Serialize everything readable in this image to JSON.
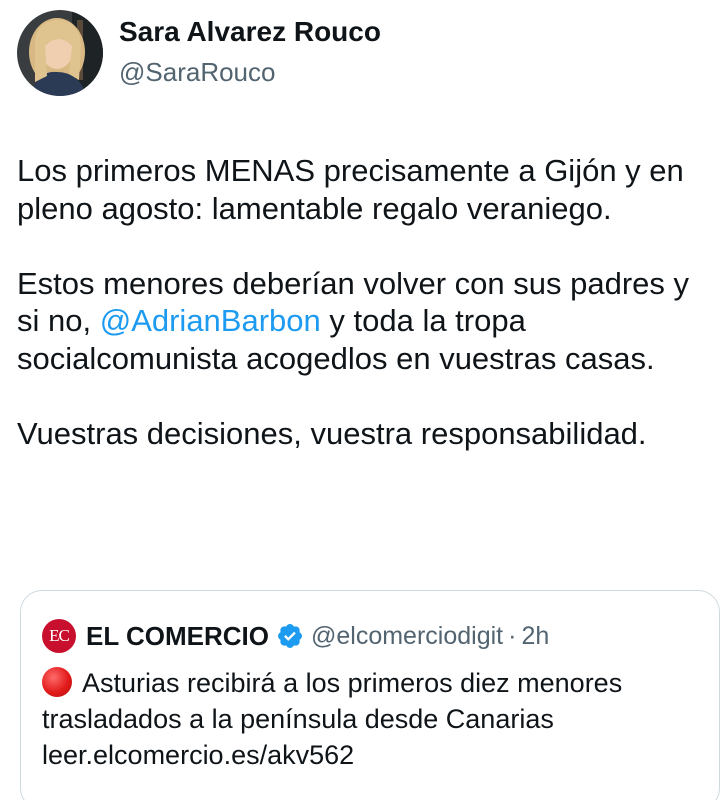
{
  "author": {
    "name": "Sara Alvarez Rouco",
    "handle": "@SaraRouco",
    "avatar_icon": "profile-photo"
  },
  "tweet": {
    "paragraph1": "Los primeros MENAS precisamente a Gijón y en pleno agosto: lamentable regalo veraniego.",
    "paragraph2_before": "Estos menores deberían volver con sus padres y si no, ",
    "paragraph2_mention": "@AdrianBarbon",
    "paragraph2_after": " y toda la tropa socialcomunista  acogedlos en vuestras casas.",
    "paragraph3": "Vuestras decisiones, vuestra responsabilidad."
  },
  "quoted": {
    "logo_text": "EC",
    "name": "EL COMERCIO",
    "handle": "@elcomerciodigit",
    "separator": "·",
    "time": "2h",
    "text_line1": "Asturias recibirá a los primeros diez menores",
    "text_line2": "trasladados a la península desde Canarias",
    "link": "leer.elcomercio.es/akv562",
    "icons": [
      "verified-badge-icon",
      "red-circle-icon"
    ]
  },
  "colors": {
    "text": "#0f1419",
    "secondary": "#536471",
    "link": "#1d9bf0",
    "brand_red": "#c8102e",
    "border": "#cfd9de"
  }
}
